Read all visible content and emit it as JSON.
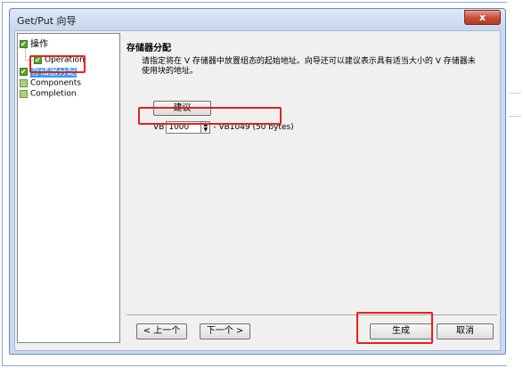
{
  "window": {
    "title": "Get/Put 向导",
    "close_label": "x"
  },
  "tree": {
    "items": [
      {
        "label": "操作",
        "checked": true
      },
      {
        "label": "Operation",
        "checked": true
      },
      {
        "label": "存储器分配",
        "checked": true,
        "selected": true
      },
      {
        "label": "Components",
        "checked": false
      },
      {
        "label": "Completion",
        "checked": false
      }
    ]
  },
  "content": {
    "heading": "存储器分配",
    "description": "请指定将在 V 存储器中放置组态的起始地址。向导还可以建议表示具有适当大小的 V 存储器未使用块的地址。",
    "suggest_label": "建议",
    "vb_prefix": "VB",
    "vb_value": "1000",
    "vb_range": "- VB1049 (50 bytes)"
  },
  "buttons": {
    "prev_label": "< 上一个",
    "next_label": "下一个 >",
    "generate_label": "生成",
    "cancel_label": "取消"
  },
  "colors": {
    "highlight": "#e2231a",
    "selection": "#3399ff",
    "client_bg": "#f0f0f0"
  }
}
